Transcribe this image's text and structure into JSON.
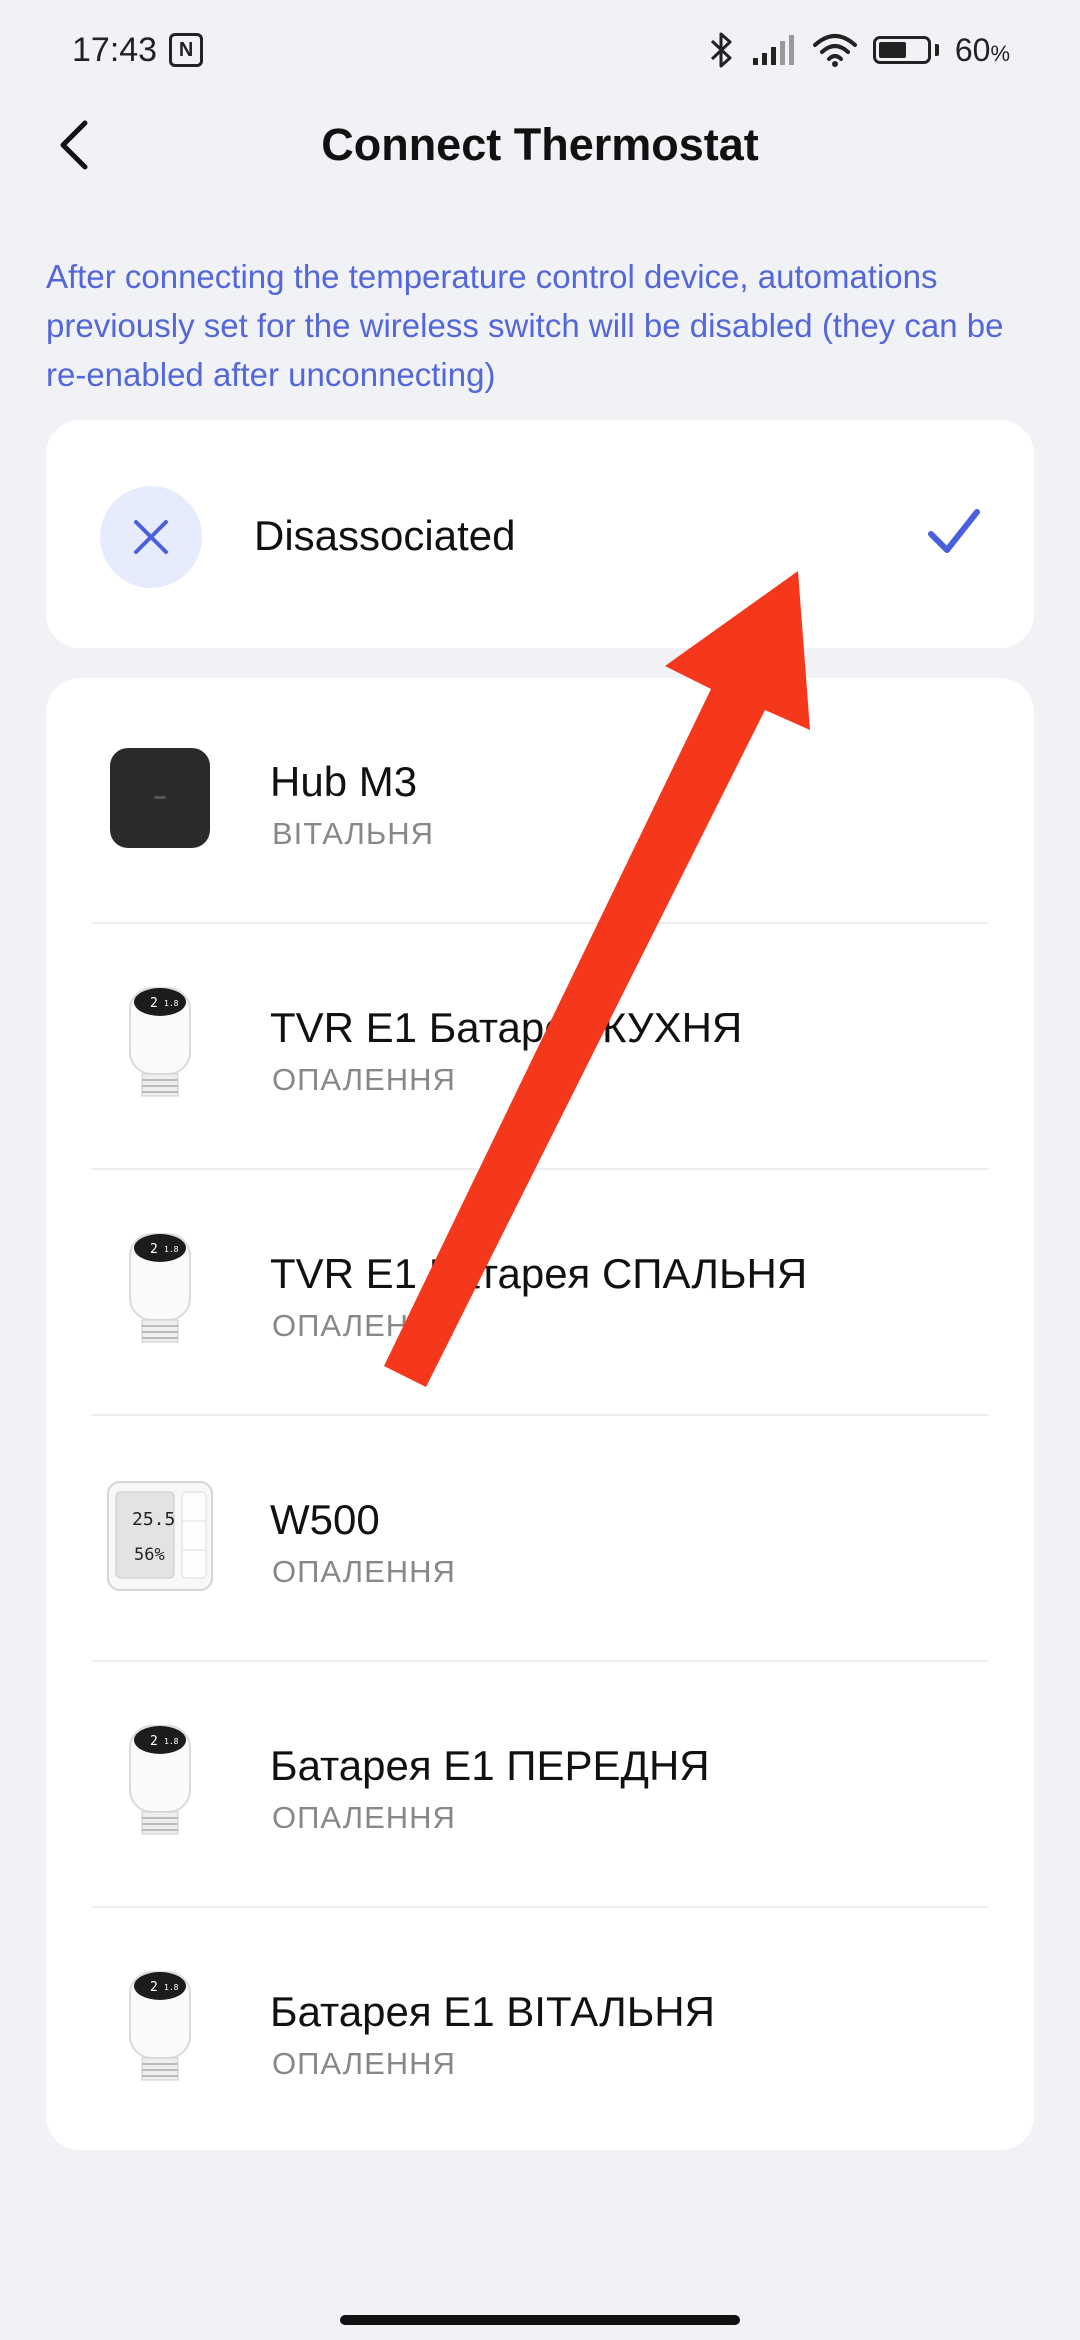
{
  "status_bar": {
    "time": "17:43",
    "nfc_icon": "N",
    "battery_percent": "60",
    "battery_unit": "%",
    "battery_level": 0.6
  },
  "header": {
    "title": "Connect Thermostat",
    "back_icon": "chevron-left-icon"
  },
  "notice": "After connecting the temperature control device, automations previously set for the wireless switch will be disabled (they can be re-enabled after unconnecting)",
  "disassociated": {
    "label": "Disassociated",
    "selected": true,
    "accent": "#4a5fdb"
  },
  "devices": [
    {
      "name": "Hub M3",
      "room": "ВІТАЛЬНЯ",
      "icon": "hub-icon"
    },
    {
      "name": "TVR E1 Батарея КУХНЯ",
      "room": "ОПАЛЕННЯ",
      "icon": "radiator-valve-icon",
      "display": [
        "2",
        "1.8"
      ]
    },
    {
      "name": "TVR E1 Батарея СПАЛЬНЯ",
      "room": "ОПАЛЕННЯ",
      "icon": "radiator-valve-icon",
      "display": [
        "2",
        "1.8"
      ]
    },
    {
      "name": "W500",
      "room": "ОПАЛЕННЯ",
      "icon": "wall-thermostat-icon",
      "display": [
        "25.5",
        "56%"
      ]
    },
    {
      "name": "Батарея E1 ПЕРЕДНЯ",
      "room": "ОПАЛЕННЯ",
      "icon": "radiator-valve-icon",
      "display": [
        "2",
        "1.8"
      ]
    },
    {
      "name": "Батарея E1 ВІТАЛЬНЯ",
      "room": "ОПАЛЕННЯ",
      "icon": "radiator-valve-icon",
      "display": [
        "2",
        "1.8"
      ]
    }
  ],
  "colors": {
    "background": "#f1f2f6",
    "accent": "#5467d8",
    "annotation_arrow": "#f5371b"
  }
}
